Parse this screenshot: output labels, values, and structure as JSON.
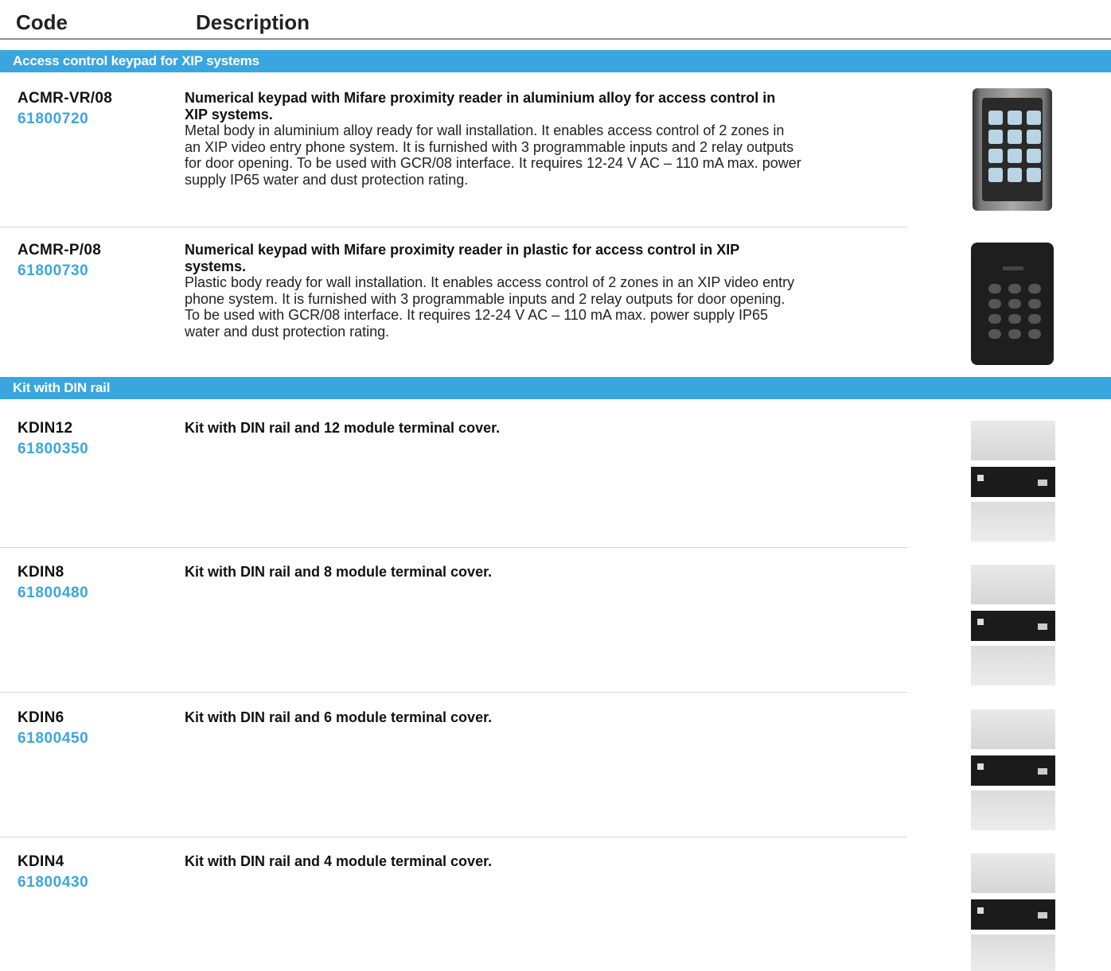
{
  "header": {
    "code_label": "Code",
    "description_label": "Description"
  },
  "sections": [
    {
      "title": "Access control keypad for XIP systems",
      "products": [
        {
          "code": "ACMR-VR/08",
          "number": "61800720",
          "title": "Numerical keypad with Mifare proximity reader in aluminium alloy for access control in XIP systems.",
          "body": "Metal body in aluminium alloy ready for wall installation. It enables access control of 2 zones in an XIP video entry phone system. It is furnished with 3 programmable inputs and 2 relay outputs for door opening. To be used with GCR/08 interface. It requires 12-24 V AC – 110 mA max. power supply IP65 water and dust protection rating.",
          "image": "metal-keypad-image"
        },
        {
          "code": "ACMR-P/08",
          "number": "61800730",
          "title": "Numerical keypad with Mifare proximity reader in plastic for access control in XIP systems.",
          "body": "Plastic body ready for wall installation. It enables access control of 2 zones in an XIP video entry phone system. It is furnished with 3 programmable inputs and 2 relay outputs for door opening. To be used with GCR/08 interface. It requires 12-24 V AC – 110 mA max. power supply IP65 water and dust protection rating.",
          "image": "plastic-keypad-image"
        }
      ]
    },
    {
      "title": "Kit with DIN rail",
      "products": [
        {
          "code": "KDIN12",
          "number": "61800350",
          "title": "Kit with DIN rail and 12 module terminal cover.",
          "image": "din-kit-image"
        },
        {
          "code": "KDIN8",
          "number": "61800480",
          "title": "Kit with DIN rail and 8 module terminal cover.",
          "image": "din-kit-image"
        },
        {
          "code": "KDIN6",
          "number": "61800450",
          "title": "Kit with DIN rail and 6 module terminal cover.",
          "image": "din-kit-image"
        },
        {
          "code": "KDIN4",
          "number": "61800430",
          "title": "Kit with DIN rail and 4 module terminal cover.",
          "image": "din-kit-image"
        }
      ]
    }
  ],
  "colors": {
    "accent": "#3aa6df",
    "divider": "#d9d9d9"
  }
}
